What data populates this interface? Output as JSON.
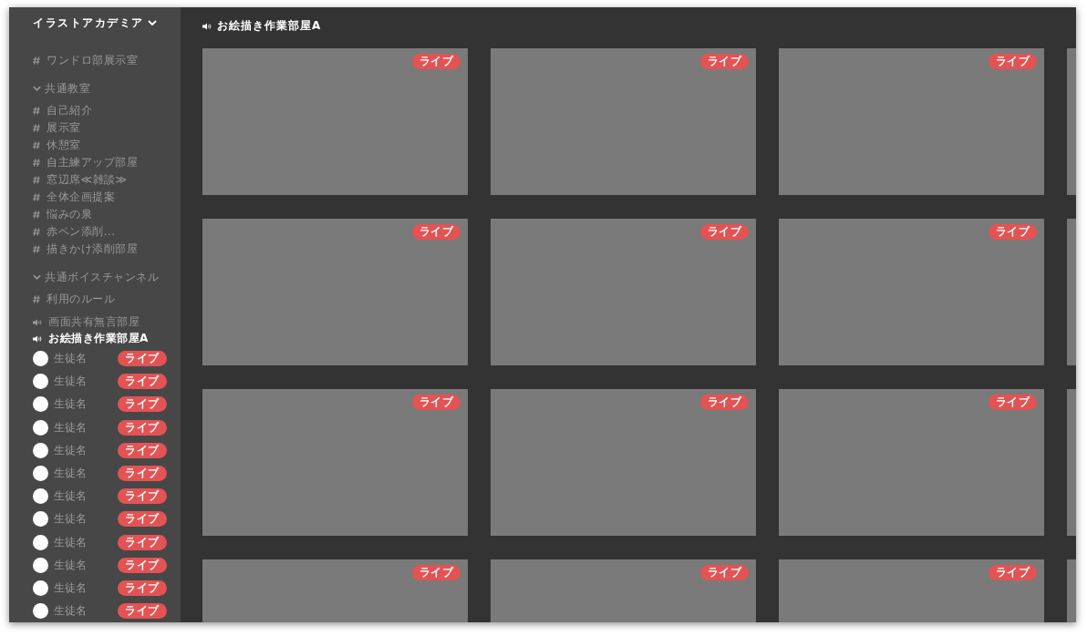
{
  "sidebar": {
    "server_name": "イラストアカデミア",
    "sections": [
      {
        "items": [
          {
            "kind": "text",
            "name": "ワンドロ部展示室",
            "selected": false
          }
        ]
      },
      {
        "title": "共通教室",
        "expanded": true,
        "items": [
          {
            "kind": "text",
            "name": "自己紹介",
            "selected": false
          },
          {
            "kind": "text",
            "name": "展示室",
            "selected": false
          },
          {
            "kind": "text",
            "name": "休憩室",
            "selected": false
          },
          {
            "kind": "text",
            "name": "自主練アップ部屋",
            "selected": false
          },
          {
            "kind": "text",
            "name": "窓辺席≪雑談≫",
            "selected": false
          },
          {
            "kind": "text",
            "name": "全体企画提案",
            "selected": false
          },
          {
            "kind": "text",
            "name": "悩みの泉",
            "selected": false
          },
          {
            "kind": "text",
            "name": "赤ペン添削...",
            "selected": false
          },
          {
            "kind": "text",
            "name": "描きかけ添削部屋",
            "selected": false
          }
        ]
      },
      {
        "title": "共通ボイスチャンネル",
        "expanded": true,
        "items": [
          {
            "kind": "text",
            "name": "利用のルール",
            "selected": false
          },
          {
            "kind": "voice",
            "name": "画面共有無言部屋",
            "selected": false
          },
          {
            "kind": "voice",
            "name": "お絵描き作業部屋A",
            "selected": true,
            "members": [
              {
                "name": "生徒名",
                "badge": "ライブ"
              },
              {
                "name": "生徒名",
                "badge": "ライブ"
              },
              {
                "name": "生徒名",
                "badge": "ライブ"
              },
              {
                "name": "生徒名",
                "badge": "ライブ"
              },
              {
                "name": "生徒名",
                "badge": "ライブ"
              },
              {
                "name": "生徒名",
                "badge": "ライブ"
              },
              {
                "name": "生徒名",
                "badge": "ライブ"
              },
              {
                "name": "生徒名",
                "badge": "ライブ"
              },
              {
                "name": "生徒名",
                "badge": "ライブ"
              },
              {
                "name": "生徒名",
                "badge": "ライブ"
              },
              {
                "name": "生徒名",
                "badge": "ライブ"
              },
              {
                "name": "生徒名",
                "badge": "ライブ"
              }
            ]
          }
        ]
      }
    ]
  },
  "main": {
    "channel_title": "お絵描き作業部屋A",
    "streams": [
      {
        "kind": "live",
        "badge": "ライブ"
      },
      {
        "kind": "live",
        "badge": "ライブ"
      },
      {
        "kind": "live",
        "badge": "ライブ"
      },
      {
        "kind": "cut"
      },
      {
        "kind": "live",
        "badge": "ライブ"
      },
      {
        "kind": "live",
        "badge": "ライブ"
      },
      {
        "kind": "live",
        "badge": "ライブ"
      },
      {
        "kind": "cut"
      },
      {
        "kind": "live",
        "badge": "ライブ"
      },
      {
        "kind": "live",
        "badge": "ライブ"
      },
      {
        "kind": "live",
        "badge": "ライブ"
      },
      {
        "kind": "cut"
      },
      {
        "kind": "live",
        "badge": "ライブ"
      },
      {
        "kind": "live",
        "badge": "ライブ"
      },
      {
        "kind": "live",
        "badge": "ライブ"
      },
      {
        "kind": "cut"
      }
    ]
  }
}
